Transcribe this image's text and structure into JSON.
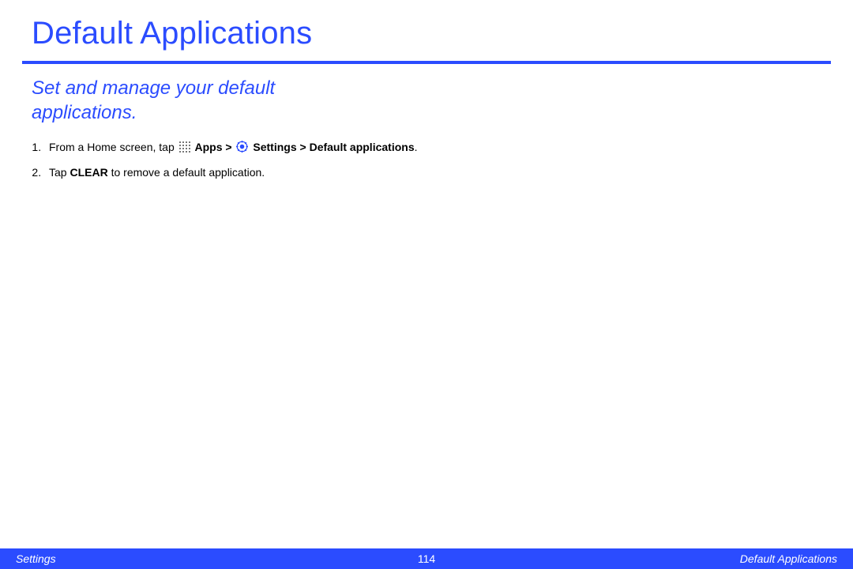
{
  "title": "Default Applications",
  "subtitle": "Set and manage your default applications.",
  "steps": {
    "s1_a": "From a Home screen, tap ",
    "s1_apps": "Apps",
    "s1_gt1": " > ",
    "s1_settings": "Settings",
    "s1_gt2": " > ",
    "s1_default": "Default applications",
    "s1_period": ".",
    "s2_a": "Tap ",
    "s2_clear": "CLEAR",
    "s2_b": " to remove a default application."
  },
  "footer": {
    "left": "Settings",
    "center": "114",
    "right": "Default Applications"
  }
}
